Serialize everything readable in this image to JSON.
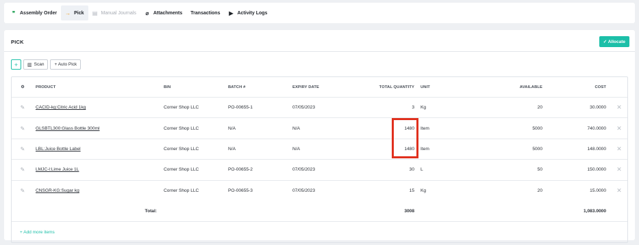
{
  "tabs": [
    {
      "label": "Assembly Order",
      "icon": "quote-icon",
      "glyph": "❞",
      "state": "normal"
    },
    {
      "label": "Pick",
      "icon": "arrow-right-icon",
      "glyph": "→",
      "state": "active"
    },
    {
      "label": "Manual Journals",
      "icon": "document-icon",
      "glyph": "▤",
      "state": "disabled"
    },
    {
      "label": "Attachments",
      "icon": "paperclip-icon",
      "glyph": "⌀",
      "state": "normal"
    },
    {
      "label": "Transactions",
      "icon": "",
      "glyph": "",
      "state": "normal"
    },
    {
      "label": "Activity Logs",
      "icon": "play-icon",
      "glyph": "▶",
      "state": "normal"
    }
  ],
  "pick": {
    "title": "PICK",
    "allocate_label": "✓ Allocate",
    "toolbar": {
      "add_label": "+",
      "scan_label": "Scan",
      "autopick_label": "+ Auto Pick"
    },
    "columns": {
      "product": "PRODUCT",
      "bin": "BIN",
      "batch": "BATCH #",
      "expiry": "EXPIRY DATE",
      "total_qty": "TOTAL QUANTITY",
      "unit": "UNIT",
      "available": "AVAILABLE",
      "cost": "COST"
    },
    "rows": [
      {
        "product": "CACID-kg:Citric Acid 1kg",
        "bin": "Corner Shop LLC",
        "batch": "PO-00655-1",
        "expiry": "07/05/2023",
        "qty": "3",
        "unit": "Kg",
        "available": "20",
        "cost": "30.0000"
      },
      {
        "product": "GLSBTL300:Glass Bottle 300ml",
        "bin": "Corner Shop LLC",
        "batch": "N/A",
        "expiry": "N/A",
        "qty": "1480",
        "unit": "Item",
        "available": "5000",
        "cost": "740.0000"
      },
      {
        "product": "LBL:Juice Bottle Label",
        "bin": "Corner Shop LLC",
        "batch": "N/A",
        "expiry": "N/A",
        "qty": "1480",
        "unit": "Item",
        "available": "5000",
        "cost": "148.0000"
      },
      {
        "product": "LMJC-l:Lime Juice 1L",
        "bin": "Corner Shop LLC",
        "batch": "PO-00655-2",
        "expiry": "07/05/2023",
        "qty": "30",
        "unit": "L",
        "available": "50",
        "cost": "150.0000"
      },
      {
        "product": "CNSGR-KG:Sugar kg",
        "bin": "Corner Shop LLC",
        "batch": "PO-00655-3",
        "expiry": "07/05/2023",
        "qty": "15",
        "unit": "Kg",
        "available": "20",
        "cost": "15.0000"
      }
    ],
    "total": {
      "label": "Total:",
      "qty": "3008",
      "cost": "1,083.0000"
    },
    "add_more_label": "+ Add more items"
  },
  "colors": {
    "accent": "#1cbfa8",
    "highlight": "#e0301e"
  }
}
